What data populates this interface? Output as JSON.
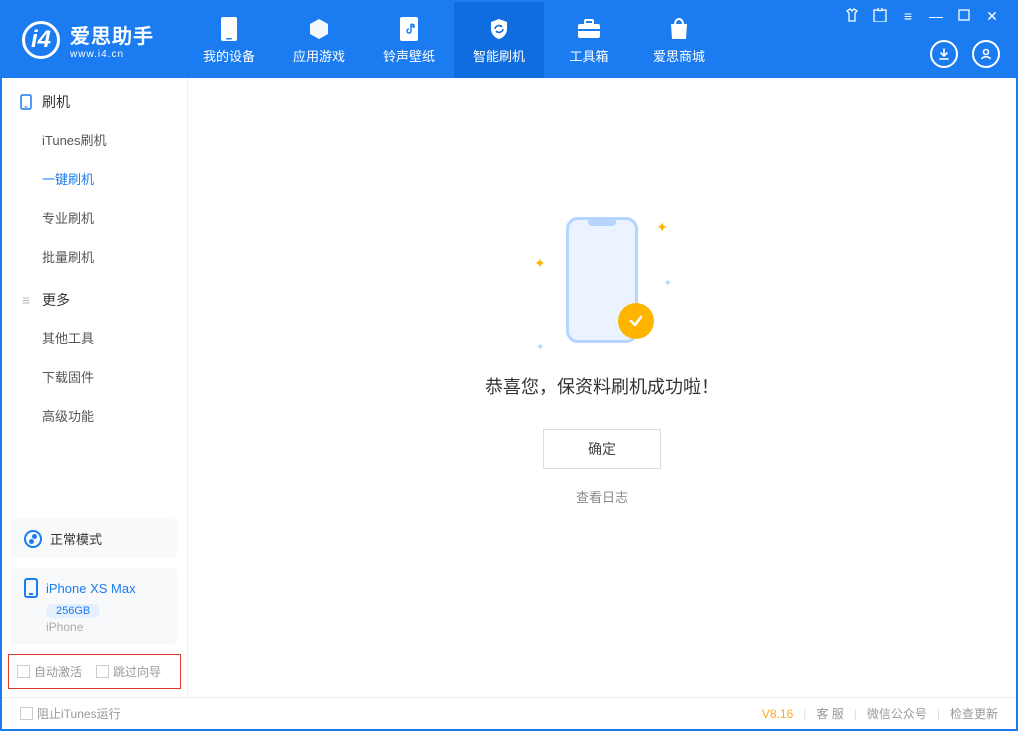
{
  "app": {
    "title": "爱思助手",
    "subtitle": "www.i4.cn"
  },
  "nav": {
    "my_device": "我的设备",
    "apps_games": "应用游戏",
    "ringtones": "铃声壁纸",
    "flash": "智能刷机",
    "toolbox": "工具箱",
    "store": "爱思商城"
  },
  "sidebar": {
    "section_flash": "刷机",
    "items_flash": {
      "itunes": "iTunes刷机",
      "onekey": "一键刷机",
      "pro": "专业刷机",
      "batch": "批量刷机"
    },
    "section_more": "更多",
    "items_more": {
      "other": "其他工具",
      "firmware": "下载固件",
      "advanced": "高级功能"
    },
    "mode": "正常模式",
    "device": {
      "name": "iPhone XS Max",
      "capacity": "256GB",
      "type": "iPhone"
    },
    "auto_activate": "自动激活",
    "skip_guide": "跳过向导"
  },
  "main": {
    "success_text": "恭喜您，保资料刷机成功啦！",
    "ok": "确定",
    "view_log": "查看日志"
  },
  "footer": {
    "block_itunes": "阻止iTunes运行",
    "version": "V8.16",
    "support": "客 服",
    "wechat": "微信公众号",
    "update": "检查更新"
  }
}
